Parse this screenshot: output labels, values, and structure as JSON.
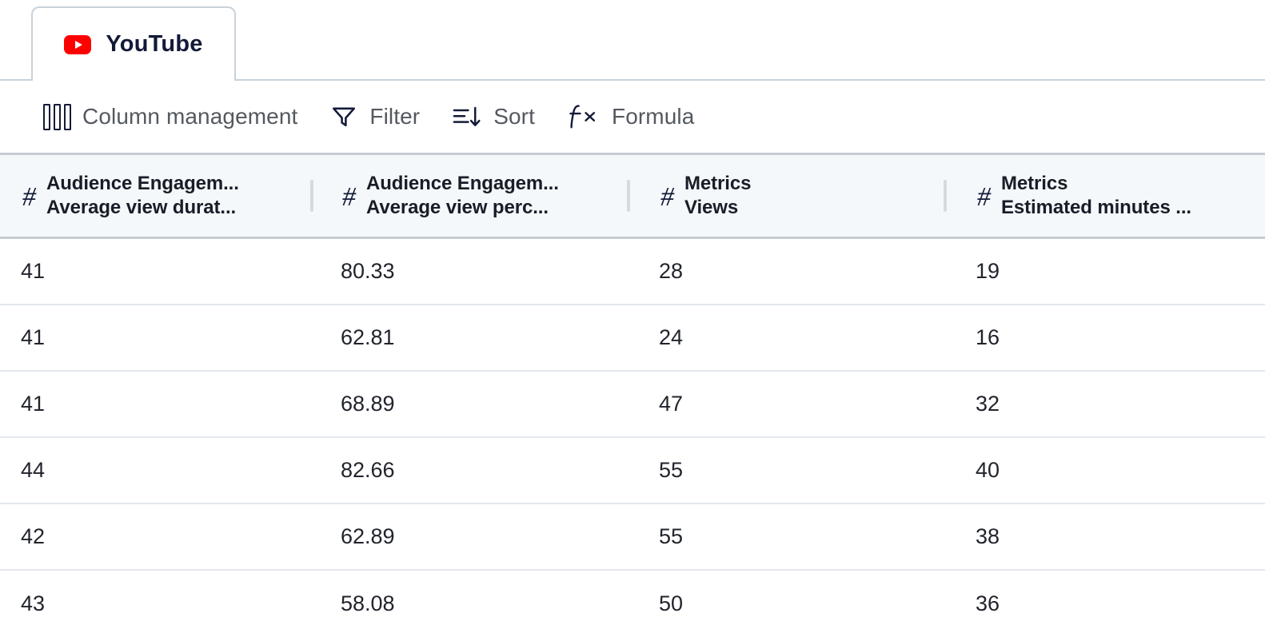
{
  "tab": {
    "label": "YouTube",
    "icon": "youtube-logo-icon",
    "active": true
  },
  "toolbar": {
    "items": [
      {
        "label": "Column management",
        "icon": "columns-icon"
      },
      {
        "label": "Filter",
        "icon": "funnel-icon"
      },
      {
        "label": "Sort",
        "icon": "sort-descending-icon"
      },
      {
        "label": "Formula",
        "icon": "fx-icon"
      }
    ]
  },
  "table": {
    "columns": [
      {
        "type_icon": "hash-icon",
        "group": "Audience Engagem...",
        "name": "Average view durat..."
      },
      {
        "type_icon": "hash-icon",
        "group": "Audience Engagem...",
        "name": "Average view perc..."
      },
      {
        "type_icon": "hash-icon",
        "group": "Metrics",
        "name": "Views"
      },
      {
        "type_icon": "hash-icon",
        "group": "Metrics",
        "name": "Estimated minutes ..."
      }
    ],
    "rows": [
      [
        "41",
        "80.33",
        "28",
        "19"
      ],
      [
        "41",
        "62.81",
        "24",
        "16"
      ],
      [
        "41",
        "68.89",
        "47",
        "32"
      ],
      [
        "44",
        "82.66",
        "55",
        "40"
      ],
      [
        "42",
        "62.89",
        "55",
        "38"
      ],
      [
        "43",
        "58.08",
        "50",
        "36"
      ]
    ]
  },
  "colors": {
    "brand_red": "#ff0000",
    "header_bg": "#f5f8fa",
    "border": "#c5ccd3",
    "row_divider": "#e3e7ee",
    "text_dark": "#131a38",
    "text_muted": "#54595f"
  }
}
